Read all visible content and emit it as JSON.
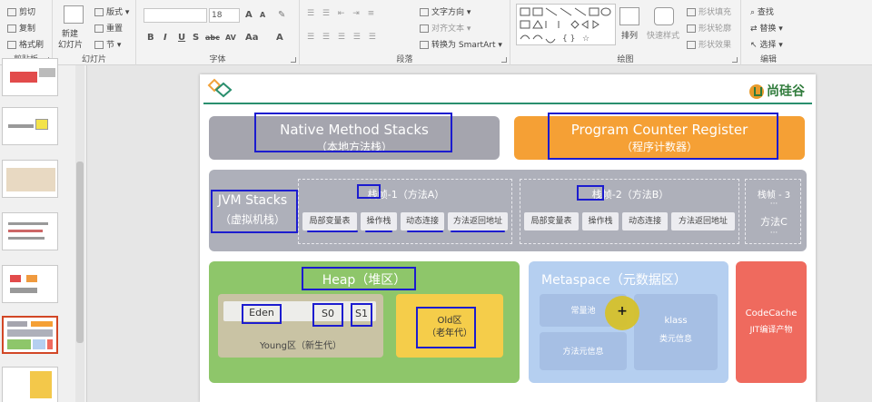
{
  "ribbon": {
    "clipboard": {
      "cut": "剪切",
      "copy": "复制",
      "format_painter": "格式刷",
      "label": "剪贴板"
    },
    "slides": {
      "new_slide": "新建",
      "new_slide_2": "幻灯片",
      "layout": "版式",
      "reset": "重置",
      "section": "节",
      "label": "幻灯片"
    },
    "font": {
      "size": "18",
      "label": "字体",
      "bold": "B",
      "italic": "I",
      "underline": "U",
      "shadow": "S",
      "strike": "abc",
      "spacing": "AV",
      "case": "Aa",
      "color": "A",
      "grow": "A",
      "shrink": "A"
    },
    "paragraph": {
      "text_direction": "文字方向",
      "align_text": "对齐文本",
      "smartart": "转换为 SmartArt",
      "label": "段落"
    },
    "drawing": {
      "arrange": "排列",
      "quick_styles": "快速样式",
      "shape_fill": "形状填充",
      "shape_outline": "形状轮廓",
      "shape_effects": "形状效果",
      "label": "绘图"
    },
    "editing": {
      "find": "查找",
      "replace": "替换",
      "select": "选择",
      "label": "编辑"
    }
  },
  "slide": {
    "brand": "尚硅谷",
    "native": {
      "title": "Native Method Stacks",
      "sub": "（本地方法栈）"
    },
    "pc": {
      "title": "Program Counter Register",
      "sub": "（程序计数器）"
    },
    "jvm": {
      "title": "JVM Stacks",
      "sub": "（虚拟机栈）"
    },
    "frame1": {
      "label": "栈帧",
      "rest": "-1（方法A）",
      "cells": [
        "局部变量表",
        "操作栈",
        "动态连接",
        "方法返回地址"
      ]
    },
    "frame2": {
      "label": "栈帧",
      "rest": "-2（方法B）",
      "cells": [
        "局部变量表",
        "操作栈",
        "动态连接",
        "方法返回地址"
      ]
    },
    "frame3": {
      "label": "栈帧 - 3",
      "dots": "···",
      "method": "方法C",
      "dots2": "···"
    },
    "heap": {
      "title": "Heap（堆区）",
      "eden": "Eden",
      "s0": "S0",
      "s1": "S1",
      "young": "Young区（新生代）",
      "old": "Old区",
      "old_sub": "（老年代）"
    },
    "meta": {
      "title": "Metaspace（元数据区）",
      "const_pool": "常量池",
      "method_info": "方法元信息",
      "klass": "klass",
      "class_info": "类元信息"
    },
    "codecache": {
      "title": "CodeCache",
      "sub": "JIT编译产物"
    },
    "cursor_symbol": "+"
  },
  "colors": {
    "highlight": "#1c1ccf",
    "orange": "#f5a035",
    "green": "#8ec66a",
    "blue": "#b5cff0",
    "red": "#ef6a5e",
    "gray": "#a5a5ae"
  }
}
